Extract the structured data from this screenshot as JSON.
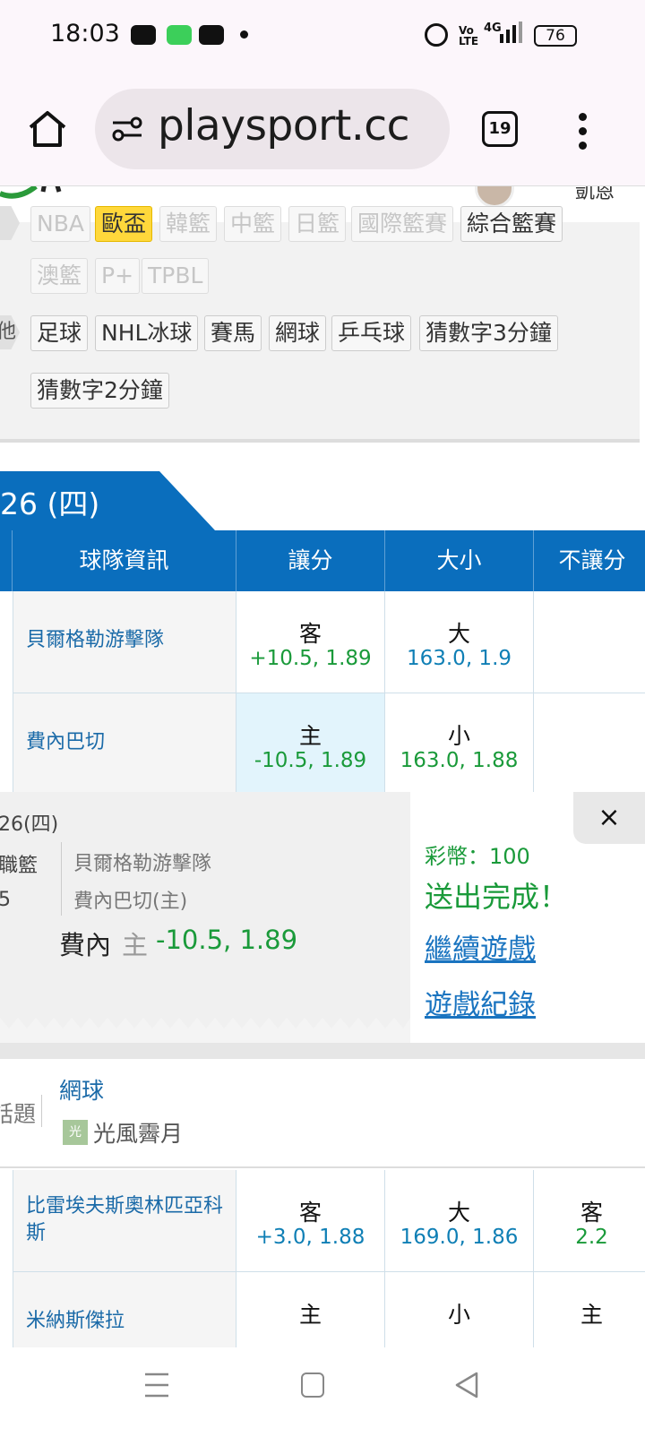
{
  "status_bar": {
    "time": "18:03",
    "battery": "76",
    "network": "4G"
  },
  "browser": {
    "url": "playsport.cc",
    "tab_count": "19"
  },
  "site_header": {
    "user_text": "凱恩"
  },
  "filter": {
    "row1": [
      {
        "label": "NBA",
        "state": "dim"
      },
      {
        "label": "歐盃",
        "state": "active"
      },
      {
        "label": "韓籃",
        "state": "dim"
      },
      {
        "label": "中籃",
        "state": "dim"
      },
      {
        "label": "日籃",
        "state": "dim"
      },
      {
        "label": "國際籃賽",
        "state": "dim"
      },
      {
        "label": "綜合籃賽",
        "state": "normal"
      }
    ],
    "row2": [
      {
        "label": "澳籃",
        "state": "dim"
      },
      {
        "label": "P+",
        "state": "dim"
      },
      {
        "label": "TPBL",
        "state": "dim"
      }
    ],
    "row3_tab": "他",
    "row3": [
      {
        "label": "足球",
        "state": "normal"
      },
      {
        "label": "NHL冰球",
        "state": "normal"
      },
      {
        "label": "賽馬",
        "state": "normal"
      },
      {
        "label": "網球",
        "state": "normal"
      },
      {
        "label": "乒乓球",
        "state": "normal"
      },
      {
        "label": "猜數字3分鐘",
        "state": "normal"
      }
    ],
    "row4": [
      {
        "label": "猜數字2分鐘",
        "state": "normal"
      }
    ]
  },
  "date_tab": "26 (四)",
  "table_header": {
    "team": "球隊資訊",
    "spread": "讓分",
    "total": "大小",
    "moneyline": "不讓分"
  },
  "game1": {
    "away": {
      "team": "貝爾格勒游擊隊",
      "spread_side": "客",
      "spread_value": "+10.5, 1.89",
      "total_side": "大",
      "total_value": "163.0, 1.9"
    },
    "home": {
      "team": "費內巴切",
      "spread_side": "主",
      "spread_value": "-10.5, 1.89",
      "total_side": "小",
      "total_value": "163.0, 1.88"
    }
  },
  "confirm": {
    "date": "26(四)",
    "league": "職籃",
    "number": "5",
    "team_away": "貝爾格勒游擊隊",
    "team_home": "費內巴切(主)",
    "pick_team": "費內",
    "pick_side": "主",
    "pick_value": "-10.5, 1.89",
    "coins": "彩幣：100",
    "status": "送出完成！",
    "continue": "繼續遊戲",
    "records": "遊戲紀錄",
    "close": "×"
  },
  "topic": {
    "label": "話題",
    "sport": "網球",
    "user_badge": "光",
    "user": "光風霽月"
  },
  "game2": {
    "away": {
      "team": "比雷埃夫斯奧林匹亞科斯",
      "spread_side": "客",
      "spread_value": "+3.0, 1.88",
      "total_side": "大",
      "total_value": "169.0, 1.86",
      "ml_side": "客",
      "ml_value": "2.2"
    },
    "home": {
      "team": "米納斯傑拉",
      "spread_side": "主",
      "total_side": "小",
      "ml_side": "主"
    }
  },
  "colors": {
    "header_blue": "#0a6ebd",
    "value_green": "#1a9a3a",
    "value_blue": "#0f7fb5",
    "active_yellow": "#ffd83b"
  }
}
